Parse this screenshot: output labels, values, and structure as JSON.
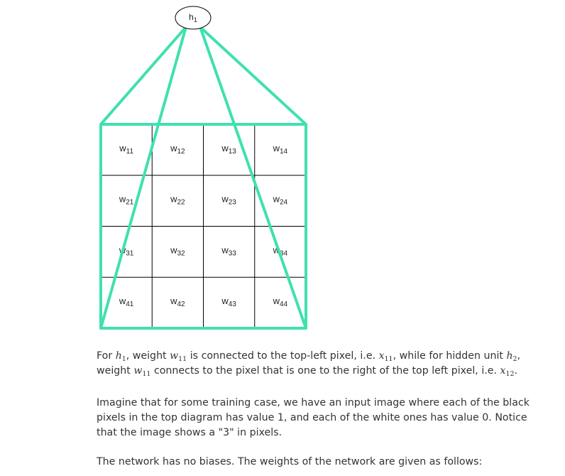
{
  "diagram": {
    "node_label": {
      "base": "h",
      "sub": "1"
    },
    "weights": [
      [
        {
          "base": "w",
          "sub": "11"
        },
        {
          "base": "w",
          "sub": "12"
        },
        {
          "base": "w",
          "sub": "13"
        },
        {
          "base": "w",
          "sub": "14"
        }
      ],
      [
        {
          "base": "w",
          "sub": "21"
        },
        {
          "base": "w",
          "sub": "22"
        },
        {
          "base": "w",
          "sub": "23"
        },
        {
          "base": "w",
          "sub": "24"
        }
      ],
      [
        {
          "base": "w",
          "sub": "31"
        },
        {
          "base": "w",
          "sub": "32"
        },
        {
          "base": "w",
          "sub": "33"
        },
        {
          "base": "w",
          "sub": "34"
        }
      ],
      [
        {
          "base": "w",
          "sub": "41"
        },
        {
          "base": "w",
          "sub": "42"
        },
        {
          "base": "w",
          "sub": "43"
        },
        {
          "base": "w",
          "sub": "44"
        }
      ]
    ],
    "highlight_color": "#40e0b0",
    "grid_color": "#000000"
  },
  "text": {
    "para1": {
      "t1": "For ",
      "m1": {
        "base": "h",
        "sub": "1"
      },
      "t2": ", weight ",
      "m2": {
        "base": "w",
        "sub": "11"
      },
      "t3": " is connected to the top-left pixel, i.e. ",
      "m3": {
        "base": "x",
        "sub": "11"
      },
      "t4": ", while for hidden unit ",
      "m4": {
        "base": "h",
        "sub": "2"
      },
      "t5": ",",
      "t6": "weight ",
      "m5": {
        "base": "w",
        "sub": "11"
      },
      "t7": " connects to the pixel that is one to the right of the top left pixel, i.e. ",
      "m6": {
        "base": "x",
        "sub": "12"
      },
      "t8": "."
    },
    "para2": "Imagine that for some training case, we have an input image where each of the black pixels in the top diagram has value 1, and each of the white ones has value 0. Notice that the image shows a \"3\" in pixels.",
    "para3": "The network has no biases. The weights of the network are given as follows:"
  }
}
